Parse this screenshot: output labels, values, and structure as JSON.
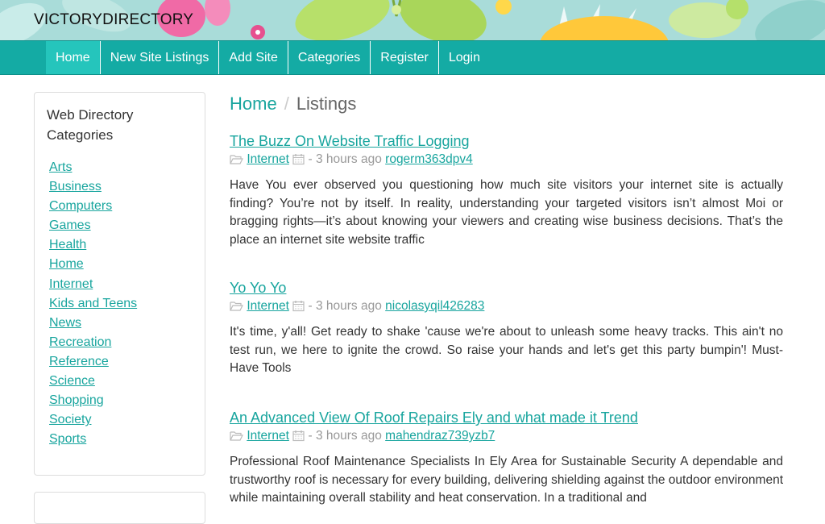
{
  "site": {
    "title": "VICTORYDIRECTORY"
  },
  "nav": {
    "items": [
      {
        "label": "Home",
        "active": true
      },
      {
        "label": "New Site Listings",
        "active": false
      },
      {
        "label": "Add Site",
        "active": false
      },
      {
        "label": "Categories",
        "active": false
      },
      {
        "label": "Register",
        "active": false
      },
      {
        "label": "Login",
        "active": false
      }
    ]
  },
  "sidebar": {
    "title": "Web Directory Categories",
    "categories": [
      "Arts",
      "Business",
      "Computers",
      "Games",
      "Health",
      "Home",
      "Internet",
      "Kids and Teens",
      "News",
      "Recreation",
      "Reference",
      "Science",
      "Shopping",
      "Society",
      "Sports"
    ]
  },
  "breadcrumb": {
    "home": "Home",
    "separator": "/",
    "current": "Listings"
  },
  "listings": [
    {
      "title": "The Buzz On Website Traffic Logging",
      "category": "Internet",
      "time": "- 3 hours ago",
      "author": "rogerm363dpv4",
      "description": "Have You ever observed you questioning how much site visitors your internet site is actually finding? You’re not by itself. In reality, understanding your targeted visitors isn’t almost Moi or bragging rights—it’s about knowing your viewers and creating wise business decisions. That’s the place an internet site website traffic"
    },
    {
      "title": "Yo Yo Yo",
      "category": "Internet",
      "time": "- 3 hours ago",
      "author": "nicolasyqil426283",
      "description": "It's time, y'all! Get ready to shake 'cause we're about to unleash some heavy tracks. This ain't no test run, we here to ignite the crowd. So raise your hands and let's get this party bumpin'! Must-Have Tools"
    },
    {
      "title": "An Advanced View Of Roof Repairs Ely and what made it Trend",
      "category": "Internet",
      "time": "- 3 hours ago",
      "author": "mahendraz739yzb7",
      "description": "Professional Roof Maintenance Specialists In Ely Area for Sustainable Security A dependable and trustworthy roof is necessary for every building, delivering shielding against the outdoor environment while maintaining overall stability and heat conservation. In a traditional and"
    }
  ],
  "colors": {
    "accent": "#18a59e",
    "navbar": "#14aba4",
    "nav_active": "#25c5bc"
  },
  "icons": {
    "category": "folder-open-icon",
    "date": "calendar-icon"
  }
}
